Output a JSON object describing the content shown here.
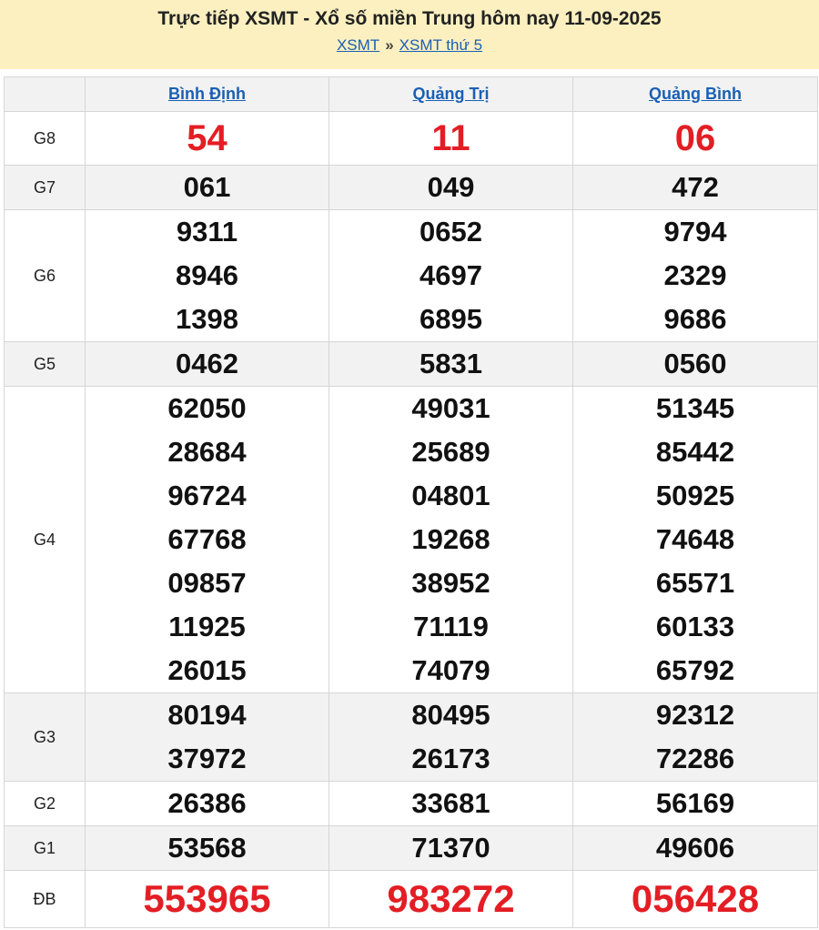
{
  "header": {
    "title": "Trực tiếp XSMT - Xổ số miền Trung hôm nay 11-09-2025",
    "crumb_1": "XSMT",
    "separator": "»",
    "crumb_2": "XSMT thứ 5"
  },
  "provinces": [
    "Bình Định",
    "Quảng Trị",
    "Quảng Bình"
  ],
  "prizes": {
    "g8": {
      "label": "G8",
      "values": [
        [
          "54"
        ],
        [
          "11"
        ],
        [
          "06"
        ]
      ]
    },
    "g7": {
      "label": "G7",
      "values": [
        [
          "061"
        ],
        [
          "049"
        ],
        [
          "472"
        ]
      ]
    },
    "g6": {
      "label": "G6",
      "values": [
        [
          "9311",
          "8946",
          "1398"
        ],
        [
          "0652",
          "4697",
          "6895"
        ],
        [
          "9794",
          "2329",
          "9686"
        ]
      ]
    },
    "g5": {
      "label": "G5",
      "values": [
        [
          "0462"
        ],
        [
          "5831"
        ],
        [
          "0560"
        ]
      ]
    },
    "g4": {
      "label": "G4",
      "values": [
        [
          "62050",
          "28684",
          "96724",
          "67768",
          "09857",
          "11925",
          "26015"
        ],
        [
          "49031",
          "25689",
          "04801",
          "19268",
          "38952",
          "71119",
          "74079"
        ],
        [
          "51345",
          "85442",
          "50925",
          "74648",
          "65571",
          "60133",
          "65792"
        ]
      ]
    },
    "g3": {
      "label": "G3",
      "values": [
        [
          "80194",
          "37972"
        ],
        [
          "80495",
          "26173"
        ],
        [
          "92312",
          "72286"
        ]
      ]
    },
    "g2": {
      "label": "G2",
      "values": [
        [
          "26386"
        ],
        [
          "33681"
        ],
        [
          "56169"
        ]
      ]
    },
    "g1": {
      "label": "G1",
      "values": [
        [
          "53568"
        ],
        [
          "71370"
        ],
        [
          "49606"
        ]
      ]
    },
    "db": {
      "label": "ĐB",
      "values": [
        [
          "553965"
        ],
        [
          "983272"
        ],
        [
          "056428"
        ]
      ]
    }
  },
  "colors": {
    "header_bg": "#fcf0c0",
    "link": "#1a5fb4",
    "special_red": "#e31e24"
  }
}
